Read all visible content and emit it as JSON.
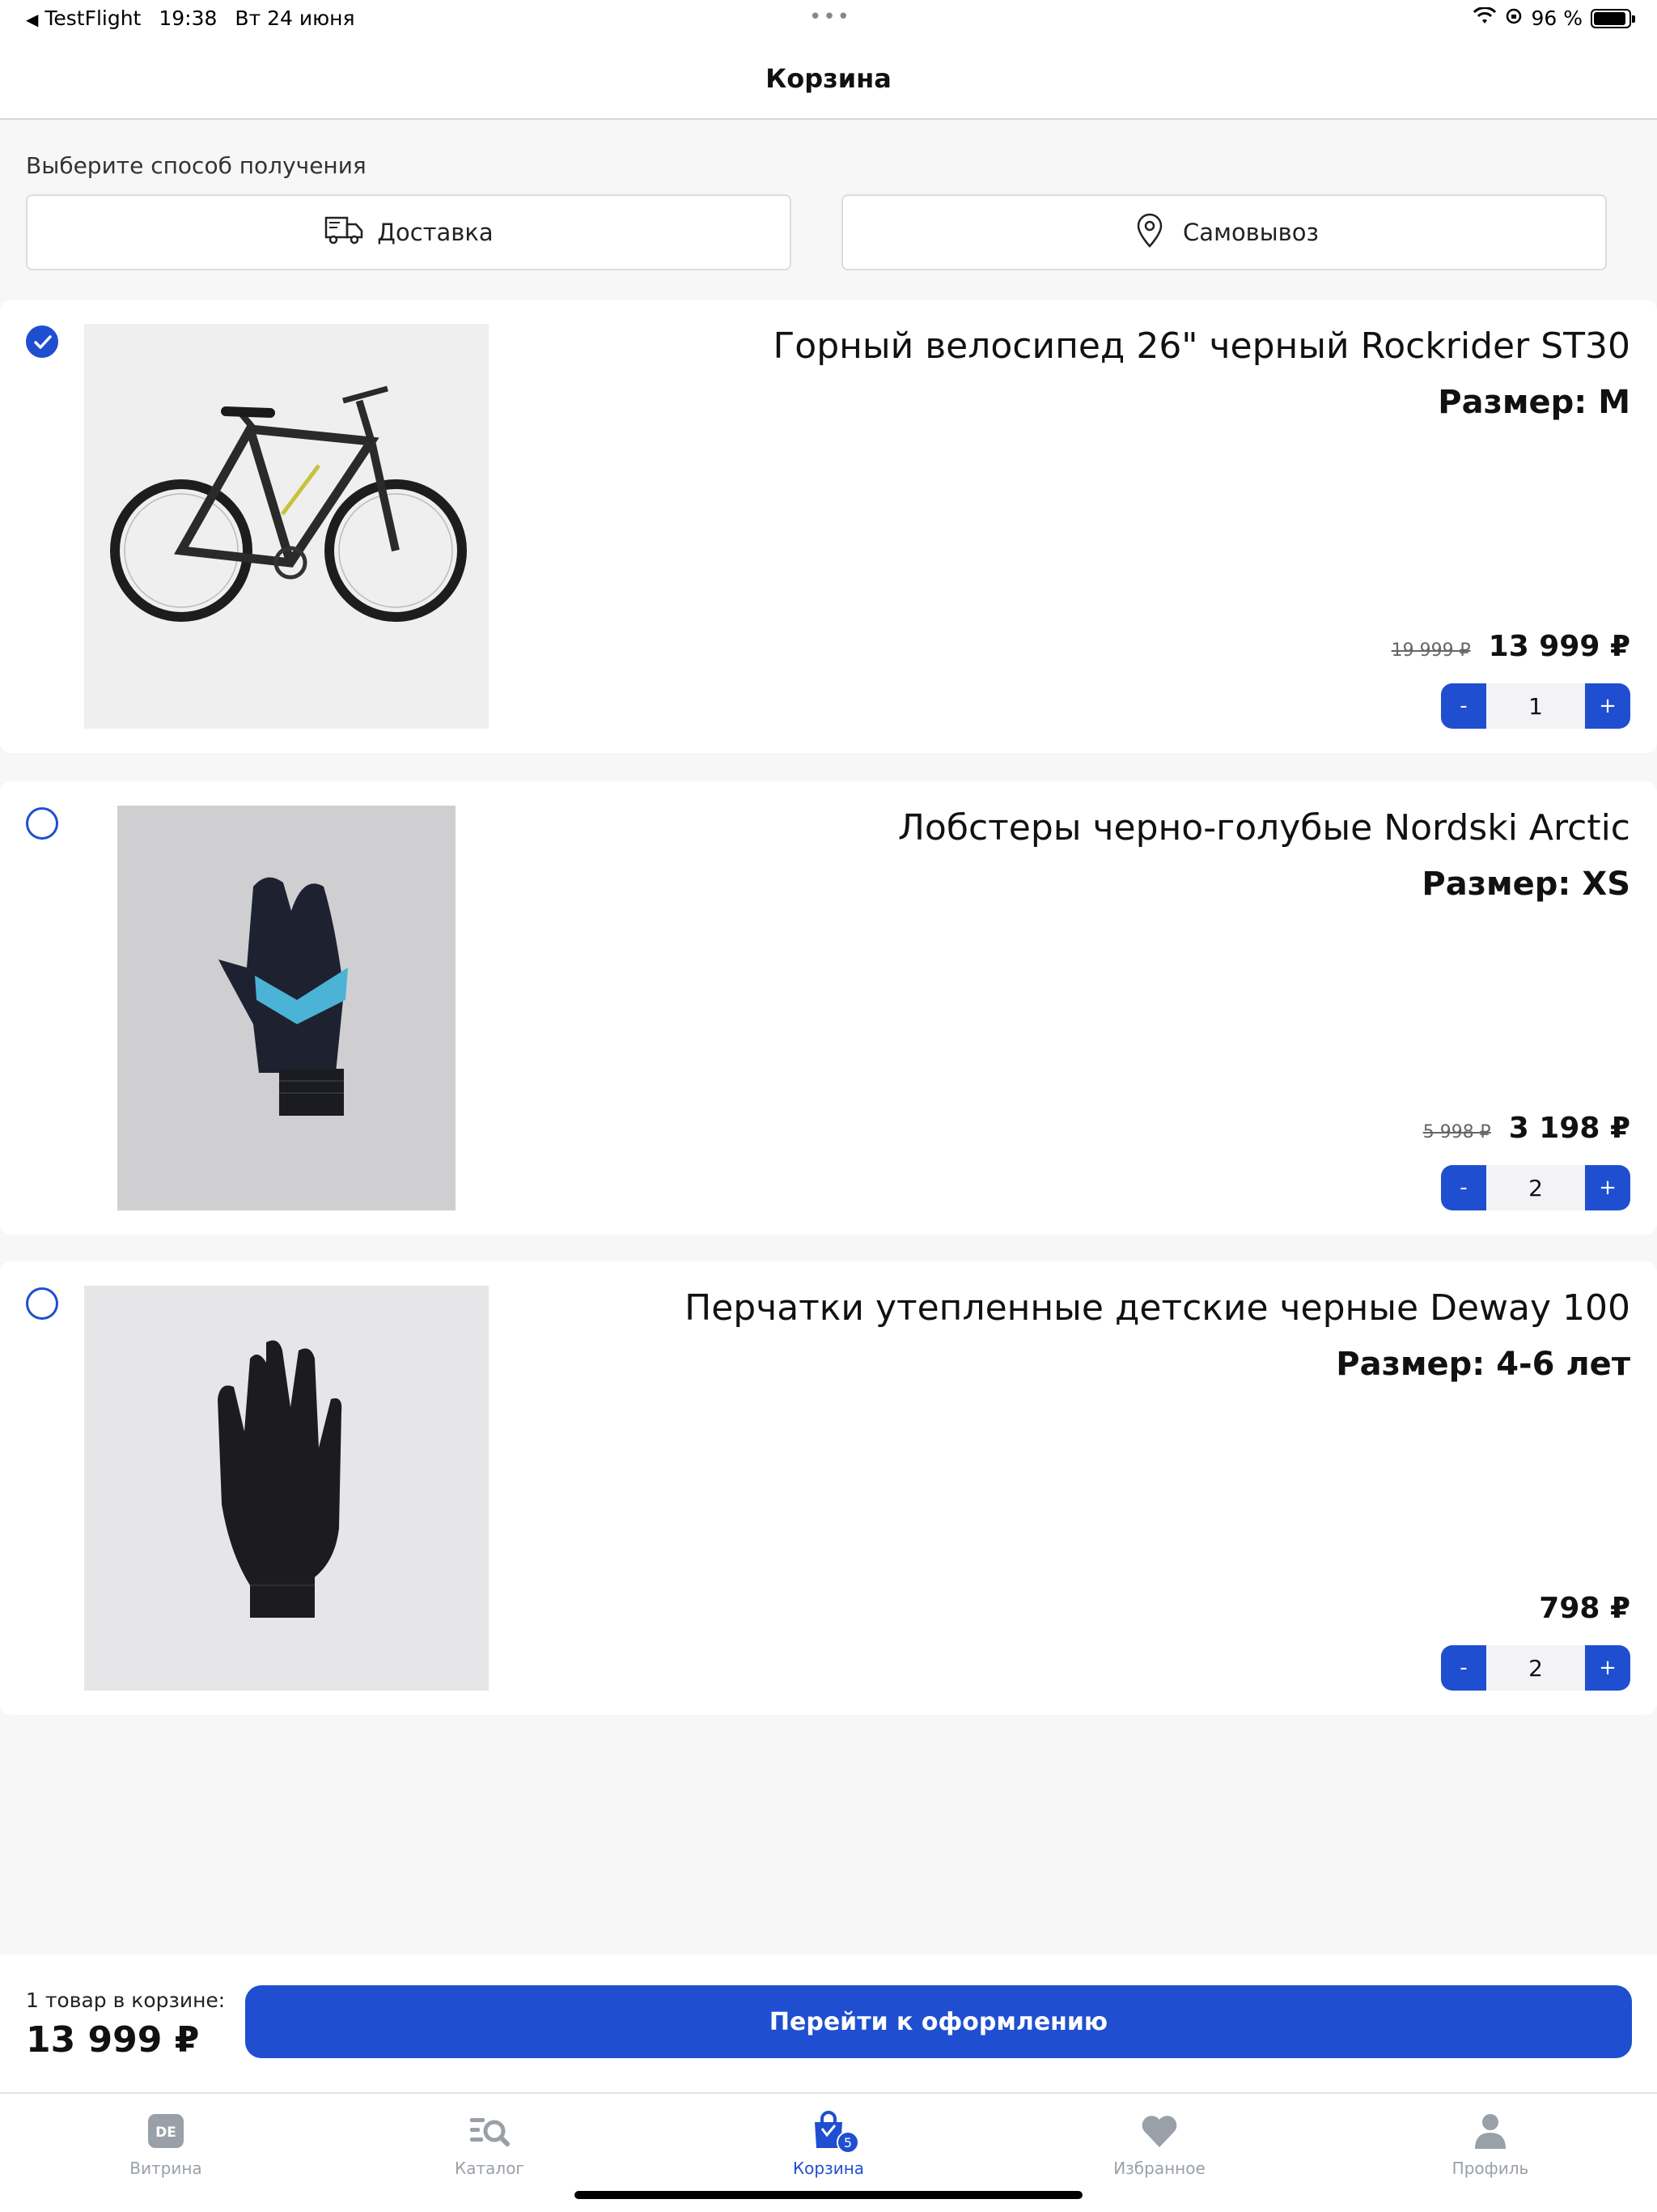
{
  "status_bar": {
    "back_app": "TestFlight",
    "time": "19:38",
    "date": "Вт 24 июня",
    "battery": "96 %"
  },
  "header": {
    "title": "Корзина"
  },
  "delivery": {
    "label": "Выберите способ получения",
    "options": [
      {
        "label": "Доставка",
        "icon": "truck-icon"
      },
      {
        "label": "Самовывоз",
        "icon": "location-pin-icon"
      }
    ]
  },
  "items": [
    {
      "title": "Горный велосипед 26\" черный Rockrider ST30",
      "size": "Размер: M",
      "old_price": "19 999 ₽",
      "price": "13 999 ₽",
      "qty": "1",
      "checked": true
    },
    {
      "title": "Лобстеры черно-голубые Nordski Arctic",
      "size": "Размер: XS",
      "old_price": "5 998 ₽",
      "price": "3 198 ₽",
      "qty": "2",
      "checked": false
    },
    {
      "title": "Перчатки утепленные детские черные Deway 100",
      "size": "Размер: 4-6 лет",
      "old_price": "",
      "price": "798 ₽",
      "qty": "2",
      "checked": false
    }
  ],
  "stepper": {
    "minus": "-",
    "plus": "+"
  },
  "summary": {
    "count_text": "1 товар в корзине:",
    "total": "13 999 ₽",
    "checkout_label": "Перейти к оформлению"
  },
  "tabbar": {
    "tabs": [
      {
        "label": "Витрина",
        "icon": "storefront-icon"
      },
      {
        "label": "Каталог",
        "icon": "catalog-search-icon"
      },
      {
        "label": "Корзина",
        "icon": "cart-bag-icon",
        "badge": "5",
        "active": true
      },
      {
        "label": "Избранное",
        "icon": "heart-icon"
      },
      {
        "label": "Профиль",
        "icon": "profile-icon"
      }
    ]
  },
  "colors": {
    "accent": "#1f4fd0",
    "background": "#f7f7f8"
  }
}
